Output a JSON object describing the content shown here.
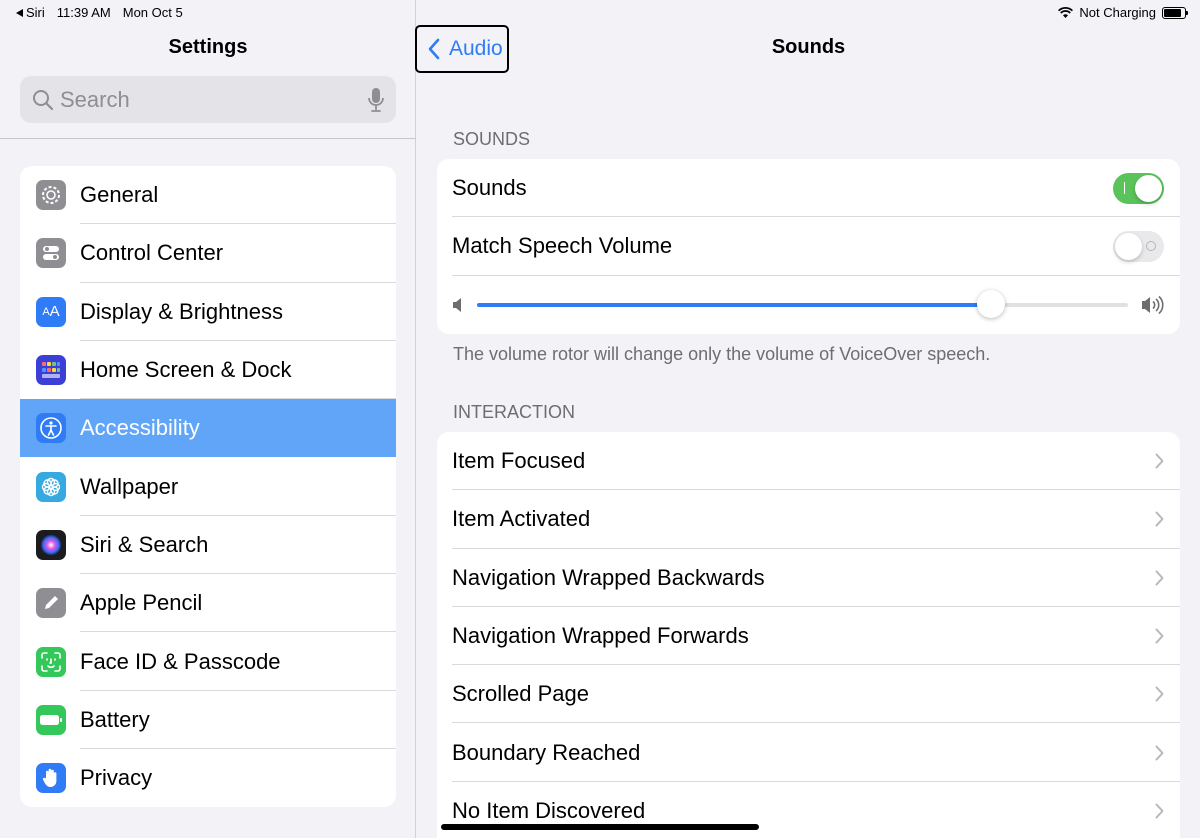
{
  "status": {
    "back_app": "Siri",
    "time": "11:39 AM",
    "date": "Mon Oct 5",
    "charging": "Not Charging",
    "battery_level": 0.85
  },
  "sidebar": {
    "title": "Settings",
    "search_placeholder": "Search",
    "items": [
      {
        "label": "General",
        "icon": "gear-icon",
        "color": "#8e8e93"
      },
      {
        "label": "Control Center",
        "icon": "toggles-icon",
        "color": "#8e8e93"
      },
      {
        "label": "Display & Brightness",
        "icon": "text-size-icon",
        "color": "#2f7cf6"
      },
      {
        "label": "Home Screen & Dock",
        "icon": "app-grid-icon",
        "color": "#3b3fd6"
      },
      {
        "label": "Accessibility",
        "icon": "accessibility-icon",
        "color": "#2f7cf6",
        "selected": true
      },
      {
        "label": "Wallpaper",
        "icon": "flower-icon",
        "color": "#36a9e0"
      },
      {
        "label": "Siri & Search",
        "icon": "siri-icon",
        "color": "#1c1c1e"
      },
      {
        "label": "Apple Pencil",
        "icon": "pencil-icon",
        "color": "#8e8e93"
      },
      {
        "label": "Face ID & Passcode",
        "icon": "face-id-icon",
        "color": "#34c759"
      },
      {
        "label": "Battery",
        "icon": "battery-icon",
        "color": "#34c759"
      },
      {
        "label": "Privacy",
        "icon": "hand-icon",
        "color": "#2f7cf6"
      }
    ]
  },
  "nav": {
    "back_label": "Audio",
    "title": "Sounds"
  },
  "sounds_section": {
    "header": "SOUNDS",
    "sounds_label": "Sounds",
    "sounds_on": true,
    "match_label": "Match Speech Volume",
    "match_on": false,
    "volume": 0.79,
    "footer": "The volume rotor will change only the volume of VoiceOver speech."
  },
  "interaction_section": {
    "header": "INTERACTION",
    "items": [
      "Item Focused",
      "Item Activated",
      "Navigation Wrapped Backwards",
      "Navigation Wrapped Forwards",
      "Scrolled Page",
      "Boundary Reached",
      "No Item Discovered"
    ]
  }
}
